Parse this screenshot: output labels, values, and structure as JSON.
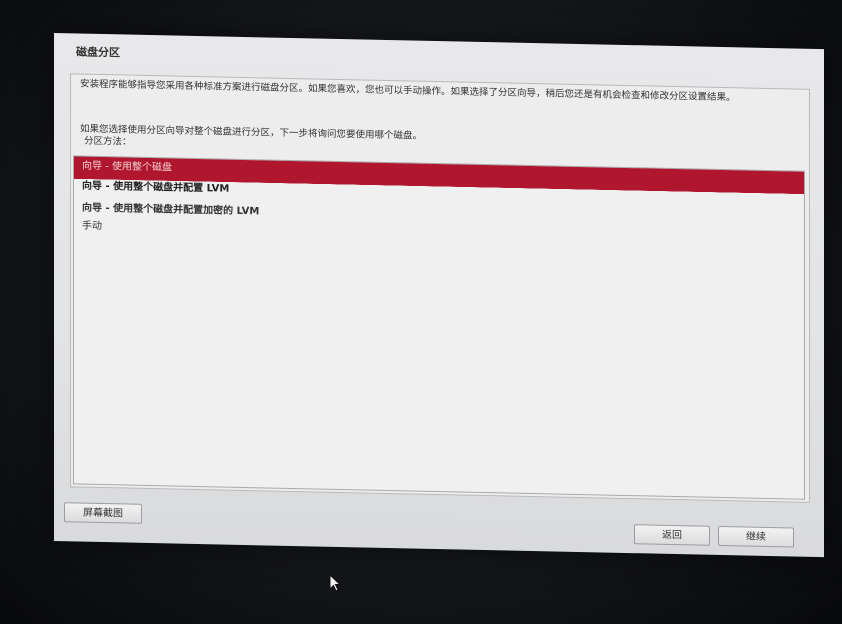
{
  "window": {
    "title": "磁盘分区"
  },
  "description": {
    "line1": "安装程序能够指导您采用各种标准方案进行磁盘分区。如果您喜欢，您也可以手动操作。如果选择了分区向导，稍后您还是有机会检查和修改分区设置结果。",
    "line2": "如果您选择使用分区向导对整个磁盘进行分区，下一步将询问您要使用哪个磁盘。",
    "method_label": "分区方法："
  },
  "partition_methods": [
    {
      "label": "向导 - 使用整个磁盘"
    },
    {
      "label": "向导 - 使用整个磁盘并配置 LVM"
    },
    {
      "label": "向导 - 使用整个磁盘并配置加密的 LVM"
    },
    {
      "label": "手动"
    }
  ],
  "buttons": {
    "screenshot": "屏幕截图",
    "back": "返回",
    "continue": "继续"
  },
  "colors": {
    "selection": "#b0172f"
  }
}
